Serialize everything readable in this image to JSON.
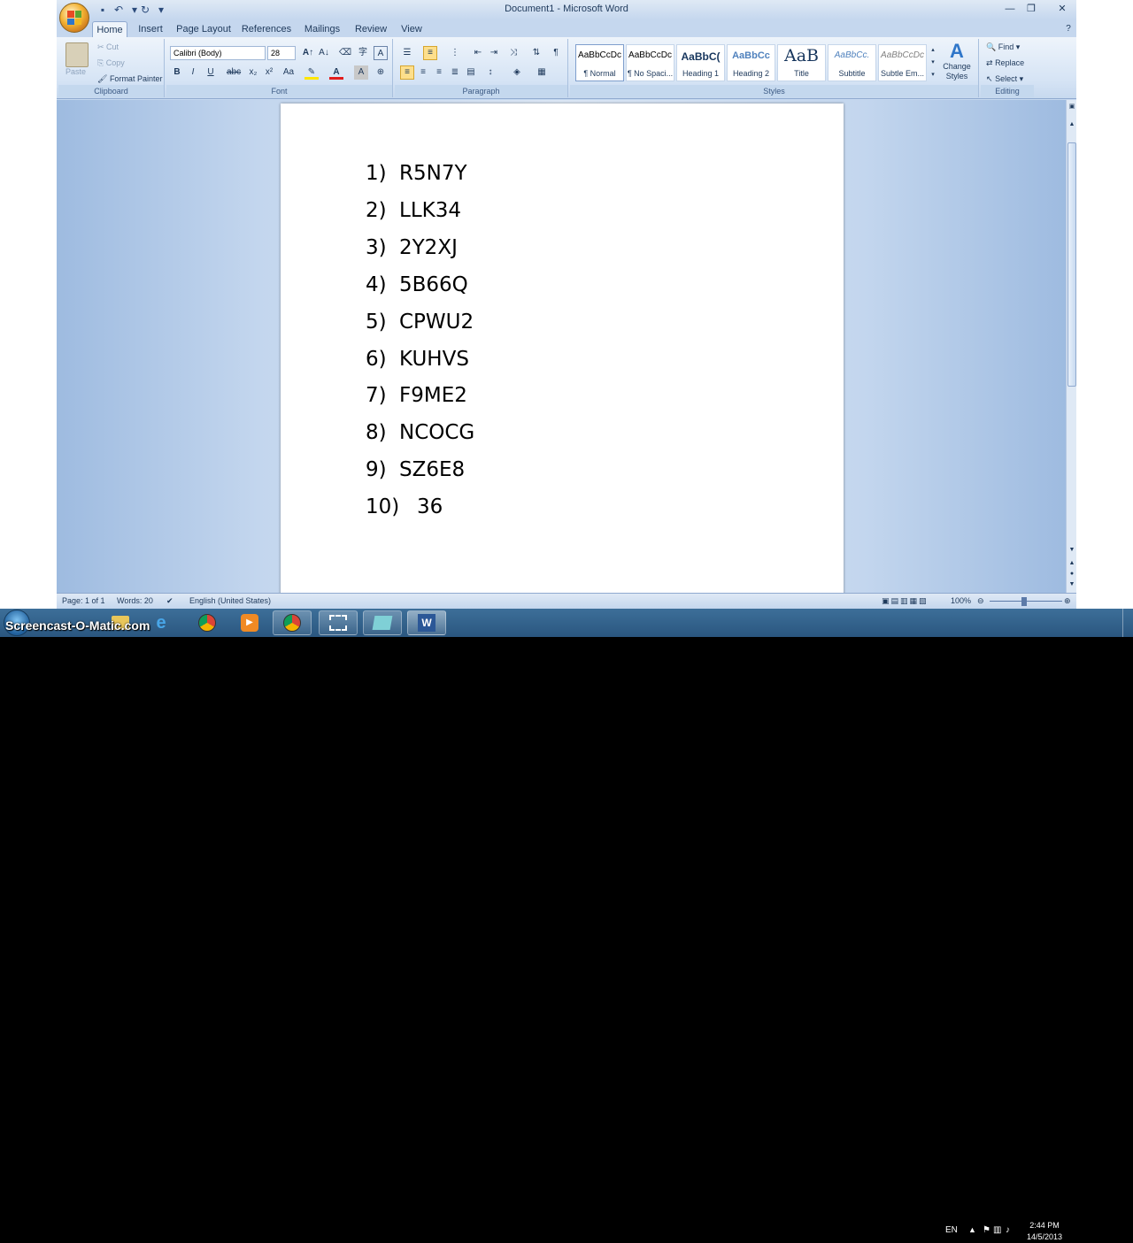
{
  "title_bar": {
    "title": "Document1 - Microsoft Word",
    "controls": [
      "minimize",
      "restore",
      "close"
    ]
  },
  "tabs": [
    "Home",
    "Insert",
    "Page Layout",
    "References",
    "Mailings",
    "Review",
    "View"
  ],
  "active_tab": "Home",
  "ribbon": {
    "clipboard": {
      "label": "Clipboard",
      "paste": "Paste",
      "cut": "Cut",
      "copy": "Copy",
      "format_painter": "Format Painter"
    },
    "font": {
      "label": "Font",
      "font_name": "Calibri (Body)",
      "font_size": "28",
      "bold": "B",
      "italic": "I",
      "underline": "U",
      "change_case": "Aa"
    },
    "paragraph": {
      "label": "Paragraph"
    },
    "styles": {
      "label": "Styles",
      "tiles": [
        {
          "preview": "AaBbCcDc",
          "label": "¶ Normal"
        },
        {
          "preview": "AaBbCcDc",
          "label": "¶ No Spaci..."
        },
        {
          "preview": "AaBbC(",
          "label": "Heading 1"
        },
        {
          "preview": "AaBbCc",
          "label": "Heading 2"
        },
        {
          "preview": "AaB",
          "label": "Title"
        },
        {
          "preview": "AaBbCc.",
          "label": "Subtitle"
        },
        {
          "preview": "AaBbCcDc",
          "label": "Subtle Em..."
        }
      ],
      "change_styles": "Change Styles"
    },
    "editing": {
      "label": "Editing",
      "find": "Find",
      "replace": "Replace",
      "select": "Select"
    }
  },
  "document": {
    "list": [
      {
        "num": "1)",
        "value": "R5N7Y"
      },
      {
        "num": "2)",
        "value": "LLK34"
      },
      {
        "num": "3)",
        "value": "2Y2XJ"
      },
      {
        "num": "4)",
        "value": "5B66Q"
      },
      {
        "num": "5)",
        "value": "CPWU2"
      },
      {
        "num": "6)",
        "value": "KUHVS"
      },
      {
        "num": "7)",
        "value": "F9ME2"
      },
      {
        "num": "8)",
        "value": "NCOCG"
      },
      {
        "num": "9)",
        "value": "SZ6E8"
      },
      {
        "num": "10)",
        "value": "36"
      }
    ]
  },
  "status_bar": {
    "page": "Page: 1 of 1",
    "words": "Words: 20",
    "language": "English (United States)",
    "zoom": "100%"
  },
  "taskbar": {
    "watermark": "Screencast-O-Matic.com",
    "language": "EN",
    "time": "2:44 PM",
    "date": "14/5/2013"
  },
  "colors": {
    "ribbon_bg": "#d6e4f5",
    "doc_bg": "#c3d6ee",
    "taskbar": "#2a567f",
    "active_align": "#fddf8c"
  }
}
